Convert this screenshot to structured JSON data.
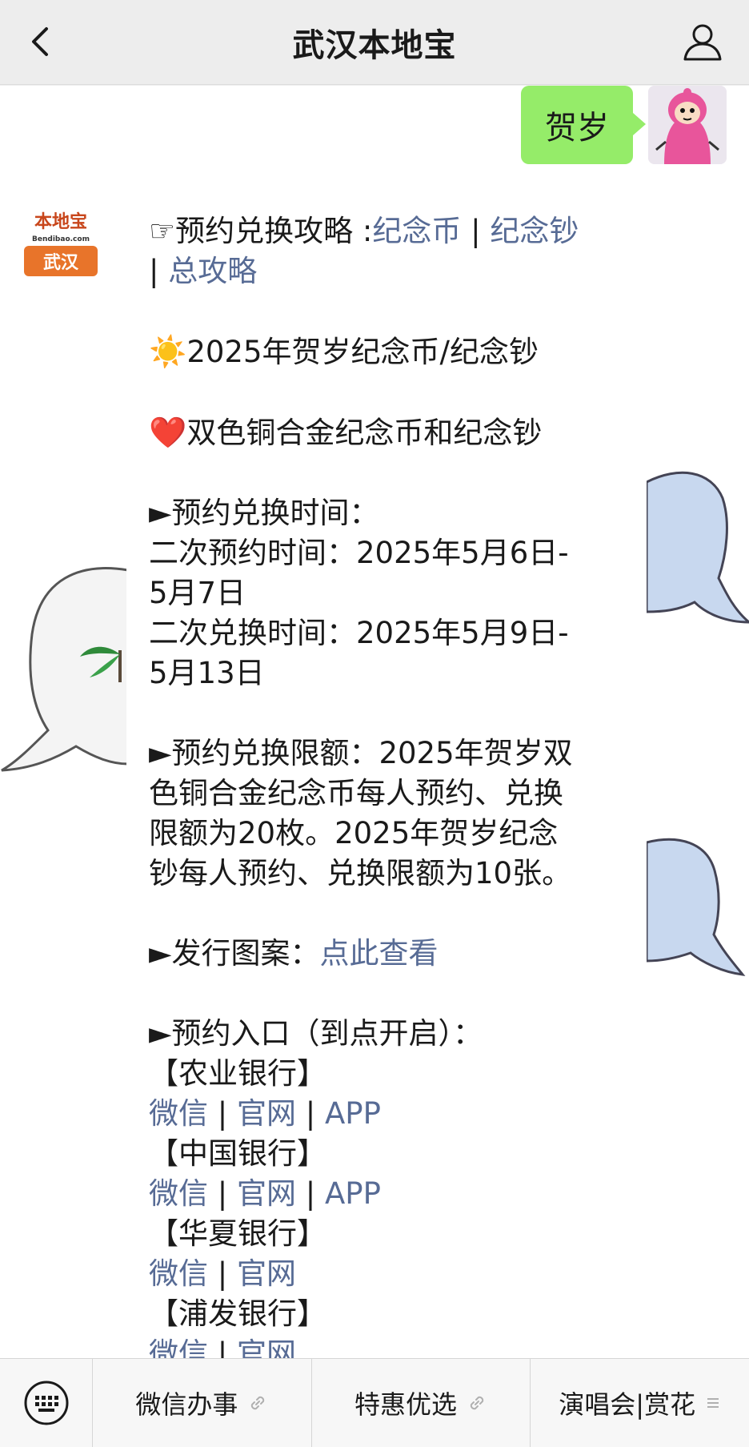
{
  "navbar": {
    "title": "武汉本地宝",
    "back_icon": "chevron-left-icon",
    "profile_icon": "user-icon"
  },
  "outgoing_message": {
    "text": "贺岁"
  },
  "bot": {
    "logo_top": "本地宝",
    "logo_domain": "Bendibao.com",
    "logo_city": "武汉"
  },
  "message": {
    "guide_prefix": "☞预约兑换攻略 :",
    "guide_link1": "纪念币",
    "guide_sep1": " | ",
    "guide_link2": "纪念钞",
    "guide_sep2": "| ",
    "guide_link3": "总攻略",
    "sun_emoji": "☀️",
    "line_title": "2025年贺岁纪念币/纪念钞",
    "heart_emoji": "❤️",
    "line_subtitle": "双色铜合金纪念币和纪念钞",
    "time_heading": "►预约兑换时间：",
    "time_line1": "二次预约时间：2025年5月6日-",
    "time_line2": "5月7日",
    "time_line3": "二次兑换时间：2025年5月9日-",
    "time_line4": "5月13日",
    "limit_line1": "►预约兑换限额：2025年贺岁双",
    "limit_line2": "色铜合金纪念币每人预约、兑换",
    "limit_line3": "限额为20枚。2025年贺岁纪念",
    "limit_line4": "钞每人预约、兑换限额为10张。",
    "design_prefix": "►发行图案：",
    "design_link": "点此查看",
    "entry_heading": "►预约入口（到点开启）：",
    "banks": [
      {
        "name": "【农业银行】",
        "links": [
          "微信",
          "官网",
          "APP"
        ]
      },
      {
        "name": "【中国银行】",
        "links": [
          "微信",
          "官网",
          "APP"
        ]
      },
      {
        "name": "【华夏银行】",
        "links": [
          "微信",
          "官网"
        ]
      },
      {
        "name": "【浦发银行】",
        "links": [
          "微信",
          "官网"
        ]
      }
    ],
    "link_sep": " | "
  },
  "bottom_menu": {
    "keyboard_icon": "keyboard-icon",
    "items": [
      {
        "label": "微信办事",
        "icon": "link-icon"
      },
      {
        "label": "特惠优选",
        "icon": "link-icon"
      },
      {
        "label": "演唱会|赏花",
        "icon": "menu-lines-icon"
      }
    ]
  },
  "colors": {
    "link": "#576b95",
    "outgoing_bubble": "#95ec69",
    "navbar_bg": "#ededed",
    "logo_orange": "#e8742a"
  }
}
